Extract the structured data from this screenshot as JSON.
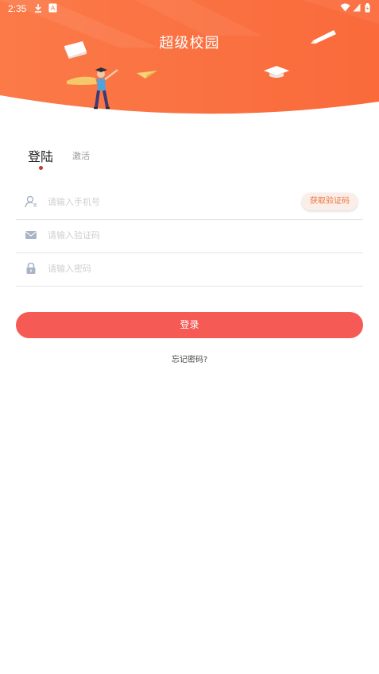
{
  "status_bar": {
    "time": "2:35",
    "icons": [
      "download-icon",
      "notification-a-icon",
      "wifi-icon",
      "signal-icon",
      "battery-icon"
    ]
  },
  "header": {
    "title": "超级校园",
    "colors": {
      "orange": "#fa6c3e",
      "orange_light": "#fb8b5b"
    }
  },
  "tabs": [
    {
      "label": "登陆",
      "active": true
    },
    {
      "label": "激活",
      "active": false
    }
  ],
  "form": {
    "phone": {
      "placeholder": "请输入手机号",
      "value": "",
      "icon": "user-icon"
    },
    "get_code_label": "获取验证码",
    "code": {
      "placeholder": "请输入验证码",
      "value": "",
      "icon": "mail-icon"
    },
    "password": {
      "placeholder": "请输入密码",
      "value": "",
      "icon": "lock-icon"
    }
  },
  "login_label": "登录",
  "forgot_label": "忘记密码?",
  "accent_color": "#f65a55"
}
